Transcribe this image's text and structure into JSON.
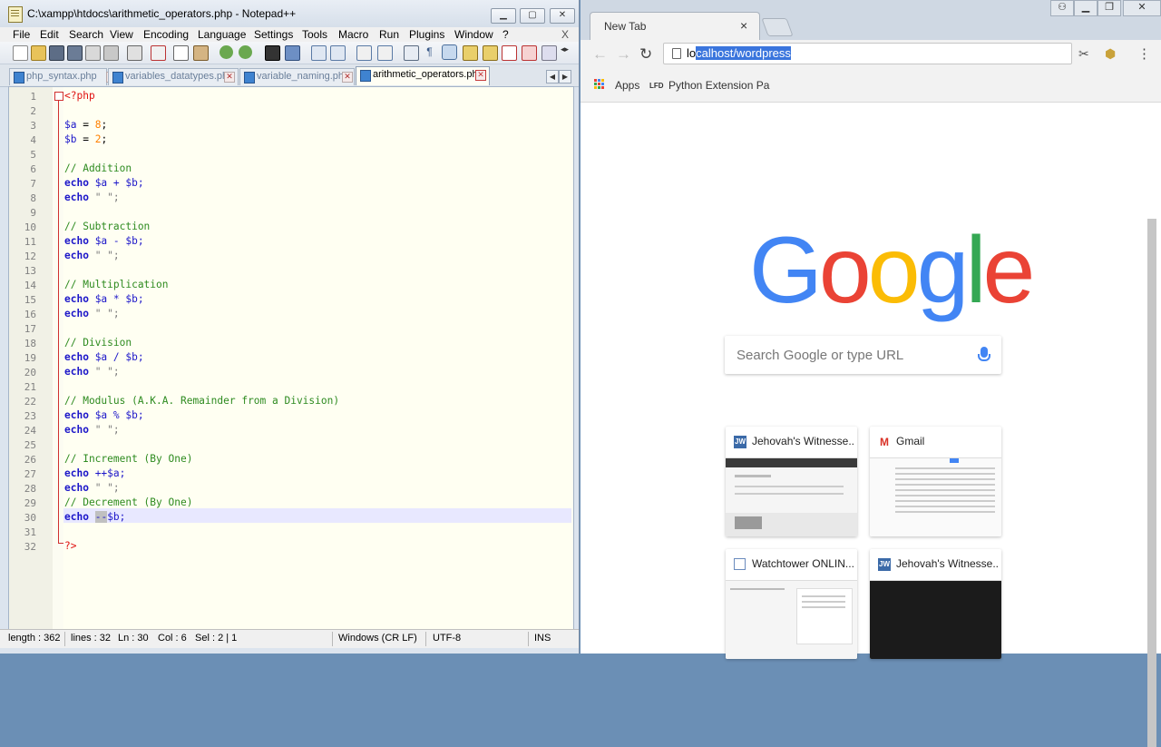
{
  "notepad": {
    "title": "C:\\xampp\\htdocs\\arithmetic_operators.php - Notepad++",
    "menu": [
      "File",
      "Edit",
      "Search",
      "View",
      "Encoding",
      "Language",
      "Settings",
      "Tools",
      "Macro",
      "Run",
      "Plugins",
      "Window",
      "?"
    ],
    "menu_close": "X",
    "tabs": [
      {
        "label": "php_syntax.php",
        "active": false
      },
      {
        "label": "variables_datatypes.php",
        "active": false
      },
      {
        "label": "variable_naming.php",
        "active": false
      },
      {
        "label": "arithmetic_operators.php",
        "active": true
      }
    ],
    "line_numbers": [
      "1",
      "2",
      "3",
      "4",
      "5",
      "6",
      "7",
      "8",
      "9",
      "10",
      "11",
      "12",
      "13",
      "14",
      "15",
      "16",
      "17",
      "18",
      "19",
      "20",
      "21",
      "22",
      "23",
      "24",
      "25",
      "26",
      "27",
      "28",
      "29",
      "30",
      "31",
      "32"
    ],
    "code": {
      "open_tag": "<?php",
      "a_var": "$a",
      "eq": " = ",
      "a_val": "8",
      "b_var": "$b",
      "b_val": "2",
      "semi": ";",
      "c_add": "// Addition",
      "c_sub": "// Subtraction",
      "c_mul": "// Multiplication",
      "c_div": "// Division",
      "c_mod": "// Modulus (A.K.A. Remainder from a Division)",
      "c_inc": "// Increment (By One)",
      "c_dec": "// Decrement (By One)",
      "echo": "echo",
      "l7": " $a + $b;",
      "l11": " $a - $b;",
      "l15": " $a * $b;",
      "l19": " $a / $b;",
      "l23": " $a % $b;",
      "l27": " ++$a;",
      "space_str": " \" \";",
      "l30_sel": "--",
      "l30_rest": "$b;",
      "close_tag": "?>"
    },
    "status": {
      "length": "length : 362",
      "lines": "lines : 32",
      "ln": "Ln : 30",
      "col": "Col : 6",
      "sel": "Sel : 2 | 1",
      "eol": "Windows (CR LF)",
      "encoding": "UTF-8",
      "mode": "INS"
    }
  },
  "chrome": {
    "tab_title": "New Tab",
    "tab_close": "×",
    "url_plain": "lo",
    "url_selected": "calhost/wordpress",
    "bookmarks": [
      "Apps",
      "Python Extension Pa"
    ],
    "lfd_label": "LFD",
    "logo": [
      "G",
      "o",
      "o",
      "g",
      "l",
      "e"
    ],
    "logo_colors": [
      "#4285f4",
      "#ea4335",
      "#fbbc05",
      "#4285f4",
      "#34a853",
      "#ea4335"
    ],
    "search_placeholder": "Search Google or type URL",
    "tiles": [
      {
        "title": "Jehovah's Witnesse...",
        "fav": "JW"
      },
      {
        "title": "Gmail",
        "fav": "M"
      },
      {
        "title": "Watchtower ONLIN...",
        "fav": ""
      },
      {
        "title": "Jehovah's Witnesse...",
        "fav": "JW"
      }
    ]
  }
}
